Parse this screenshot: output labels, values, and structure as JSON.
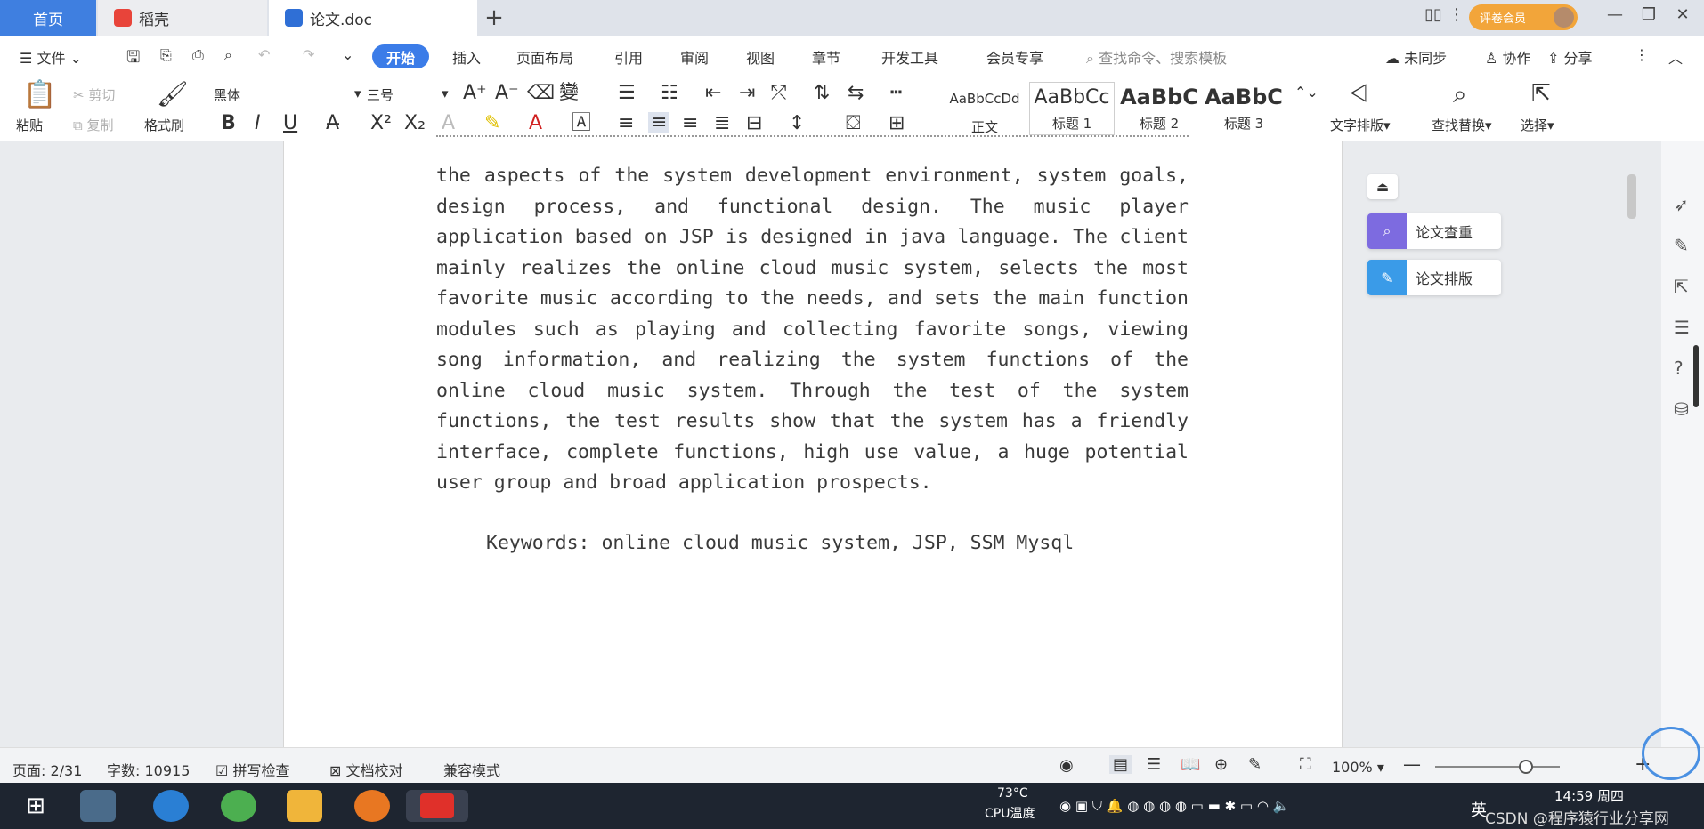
{
  "titlebar": {
    "tab_home": "首页",
    "tab_docer": "稻壳",
    "tab_doc": "论文.doc",
    "new_tab": "+",
    "vip_label": "评卷会员"
  },
  "menubar": {
    "file": "文件",
    "start": "开始",
    "insert": "插入",
    "layout": "页面布局",
    "reference": "引用",
    "review": "审阅",
    "view": "视图",
    "chapter": "章节",
    "devtools": "开发工具",
    "member": "会员专享",
    "search_placeholder": "查找命令、搜索模板",
    "sync": "未同步",
    "collab": "协作",
    "share": "分享"
  },
  "ribbon": {
    "paste": "粘贴",
    "cut": "剪切",
    "copy": "复制",
    "format_painter": "格式刷",
    "font_name": "黑体",
    "font_size": "三号",
    "styles": [
      {
        "preview": "AaBbCcDd",
        "label": "正文"
      },
      {
        "preview": "AaBbCc",
        "label": "标题 1"
      },
      {
        "preview": "AaBbC",
        "label": "标题 2"
      },
      {
        "preview": "AaBbC",
        "label": "标题 3"
      }
    ],
    "text_layout": "文字排版",
    "find_replace": "查找替换",
    "select": "选择"
  },
  "document": {
    "paragraph": "the aspects of the system development environment, system goals, design process, and functional design. The music player application based on JSP is designed in java language. The client mainly realizes the online cloud music system, selects the most favorite music according to the needs, and sets the main function modules such as playing and collecting favorite songs, viewing song information, and realizing the system functions of the online cloud music system. Through the test of the system functions, the test results show that the system has a friendly interface, complete functions, high use value, a huge potential user group and broad application prospects.",
    "keywords": "Keywords: online cloud music system, JSP, SSM Mysql"
  },
  "panel": {
    "check": "论文查重",
    "format": "论文排版"
  },
  "statusbar": {
    "page": "页面: 2/31",
    "words": "字数: 10915",
    "spell": "拼写检查",
    "proof": "文档校对",
    "compat": "兼容模式",
    "zoom": "100%"
  },
  "taskbar": {
    "temp": "73°C",
    "temp_label": "CPU温度",
    "ime": "英",
    "time": "14:59 周四",
    "watermark": "CSDN @程序猿行业分享网"
  },
  "colors": {
    "accent": "#3b7ce8",
    "titlebar": "#dfe3ea",
    "taskbar": "#1e2530"
  }
}
